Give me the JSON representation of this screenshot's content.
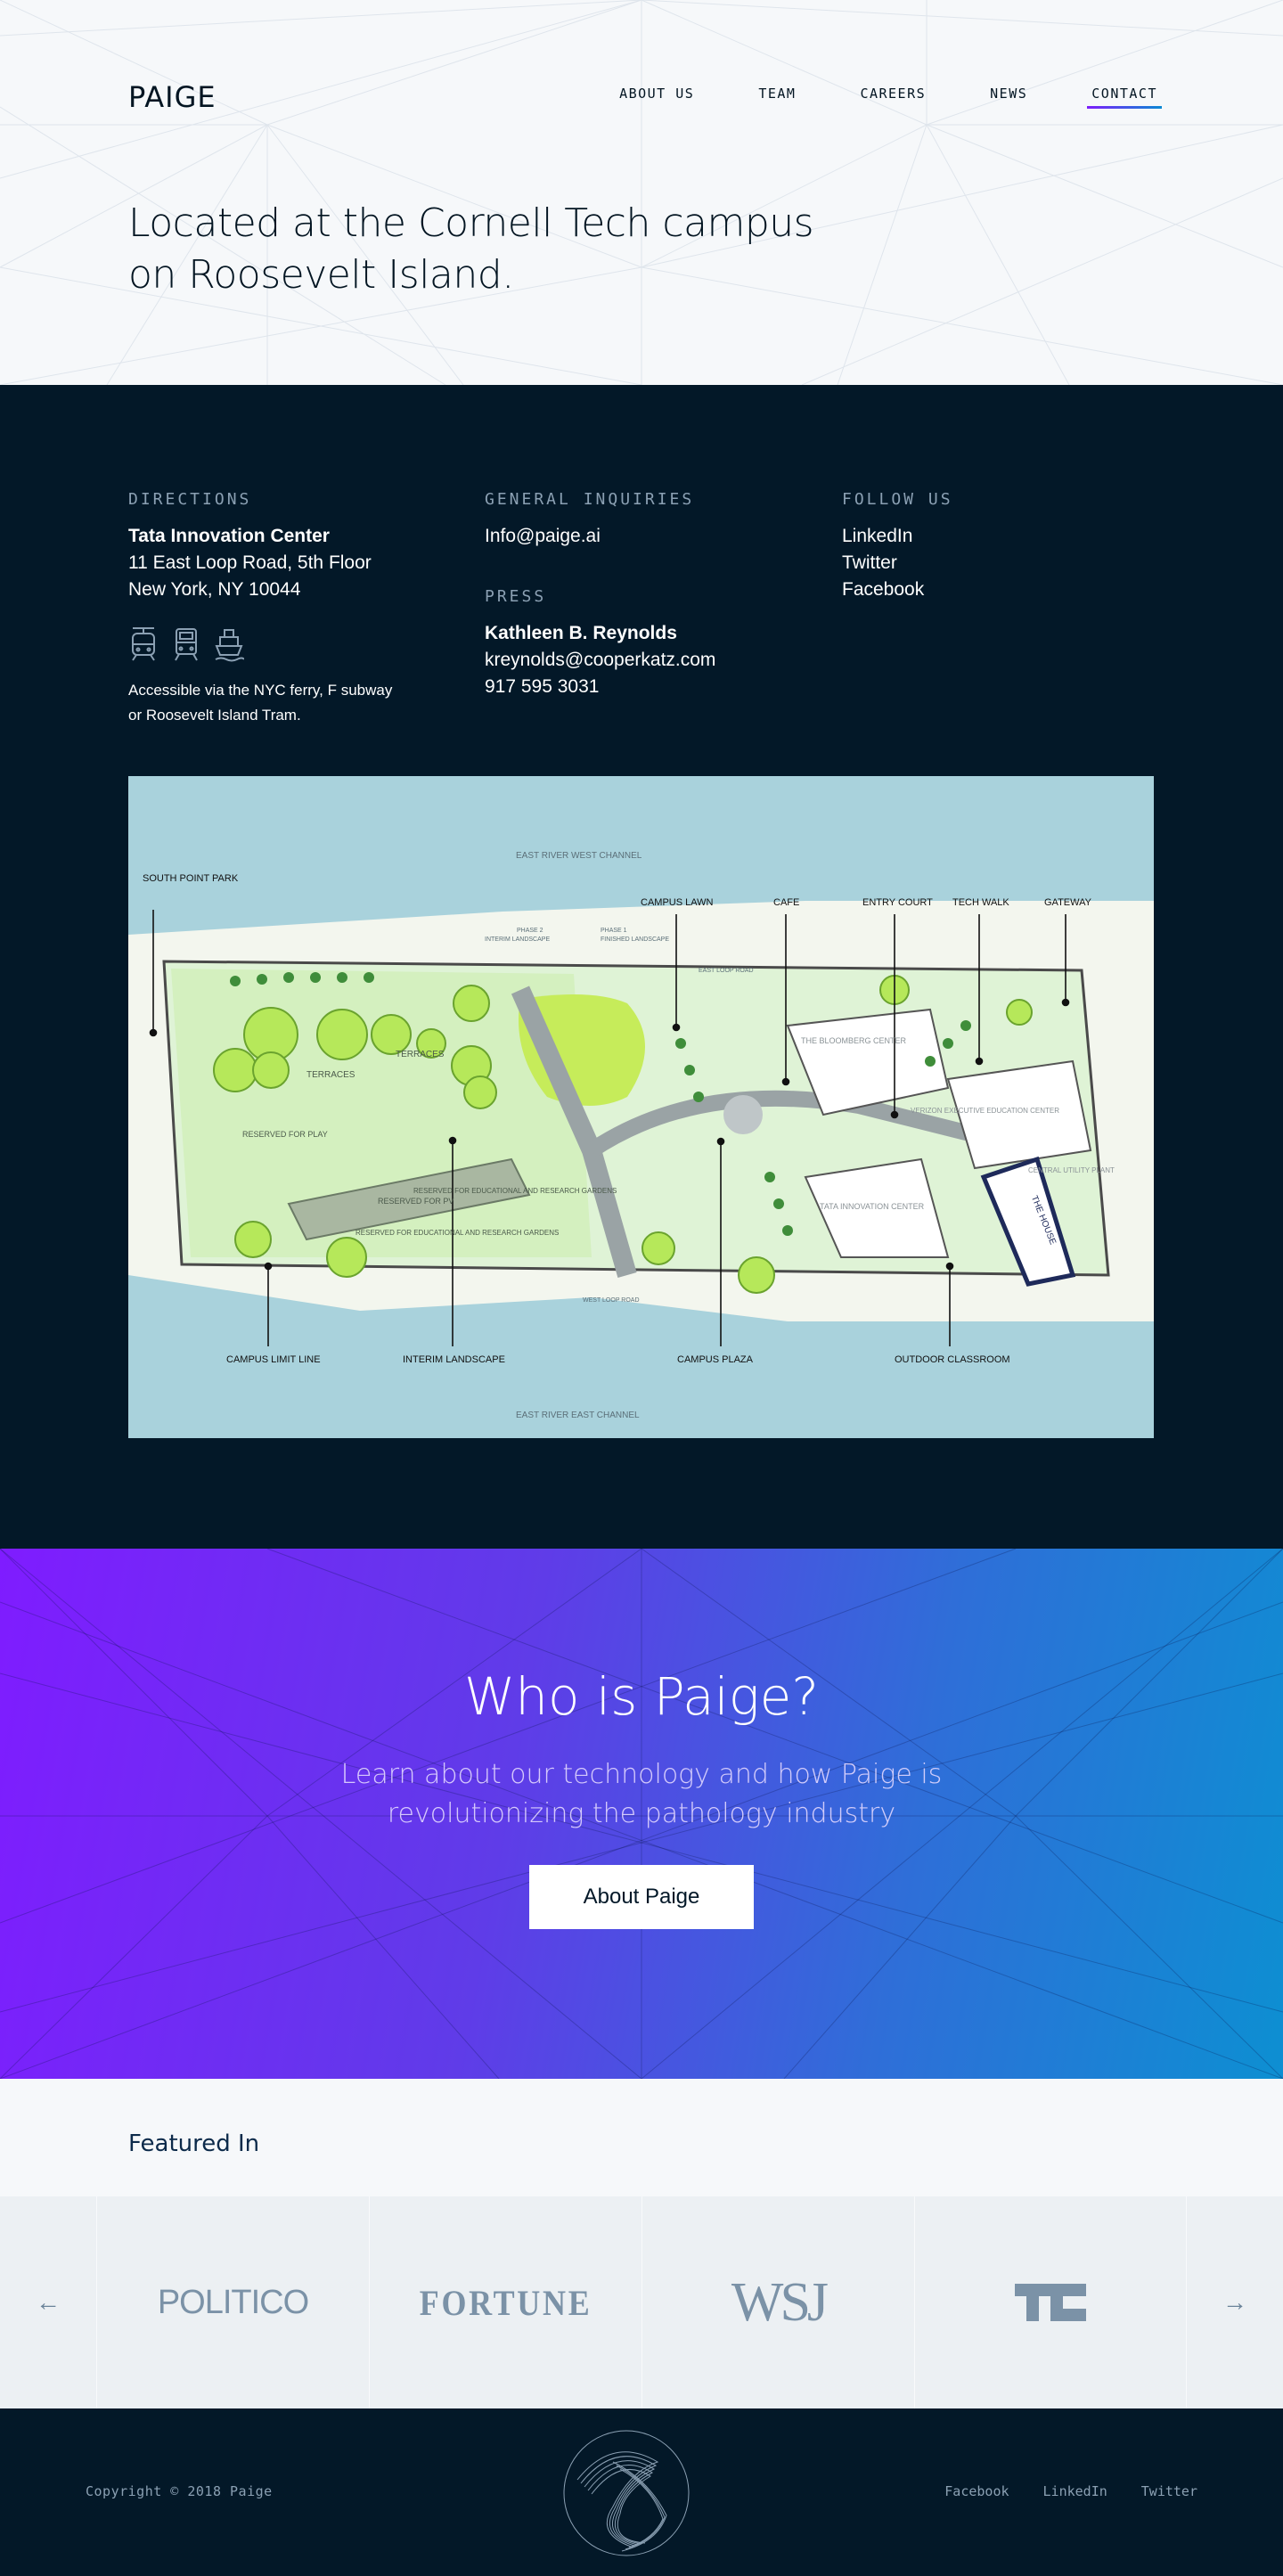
{
  "header": {
    "logo": "PAIGE",
    "nav": [
      {
        "label": "ABOUT US"
      },
      {
        "label": "TEAM"
      },
      {
        "label": "CAREERS"
      },
      {
        "label": "NEWS"
      },
      {
        "label": "CONTACT",
        "active": true
      }
    ],
    "title": "Located at the Cornell Tech campus on Roosevelt Island."
  },
  "directions": {
    "heading": "DIRECTIONS",
    "building": "Tata Innovation Center",
    "address1": "11 East Loop Road, 5th Floor",
    "address2": "New York, NY 10044",
    "transit_icons": [
      "tram-icon",
      "subway-icon",
      "ferry-icon"
    ],
    "access_note": "Accessible via the NYC ferry, F subway or Roosevelt Island Tram."
  },
  "inquiries": {
    "heading": "GENERAL INQUIRIES",
    "email": "Info@paige.ai"
  },
  "press": {
    "heading": "PRESS",
    "name": "Kathleen B. Reynolds",
    "email": "kreynolds@cooperkatz.com",
    "phone": "917 595 3031"
  },
  "follow": {
    "heading": "FOLLOW US",
    "links": [
      "LinkedIn",
      "Twitter",
      "Facebook"
    ]
  },
  "map": {
    "labels": {
      "west_channel": "EAST RIVER WEST CHANNEL",
      "east_channel": "EAST RIVER EAST CHANNEL",
      "south_point": "SOUTH POINT PARK",
      "campus_lawn": "CAMPUS LAWN",
      "cafe": "CAFE",
      "entry_court": "ENTRY COURT",
      "tech_walk": "TECH WALK",
      "gateway": "GATEWAY",
      "terraces1": "TERRACES",
      "terraces2": "TERRACES",
      "reserved_play": "RESERVED FOR PLAY",
      "reserved_pv": "RESERVED FOR PV",
      "reserved_edu": "RESERVED FOR EDUCATIONAL AND RESEARCH GARDENS",
      "reserved_edu2": "RESERVED FOR EDUCATIONAL AND RESEARCH GARDENS",
      "bloomberg": "THE BLOOMBERG CENTER",
      "verizon": "VERIZON EXECUTIVE EDUCATION CENTER",
      "tata": "TATA INNOVATION CENTER",
      "utility": "CENTRAL UTILITY PLANT",
      "house": "THE HOUSE",
      "campus_limit": "CAMPUS LIMIT LINE",
      "interim": "INTERIM LANDSCAPE",
      "plaza": "CAMPUS PLAZA",
      "classroom": "OUTDOOR CLASSROOM",
      "phase2": "PHASE 2",
      "phase1": "PHASE 1",
      "interim_small": "INTERIM LANDSCAPE",
      "finished_small": "FINISHED LANDSCAPE",
      "east_loop": "EAST LOOP ROAD",
      "west_loop": "WEST LOOP ROAD"
    }
  },
  "who": {
    "title": "Who is Paige?",
    "subtitle": "Learn about our technology and how Paige is revolutionizing the pathology industry",
    "button": "About Paige"
  },
  "featured": {
    "heading": "Featured In",
    "logos": [
      "POLITICO",
      "FORTUNE",
      "WSJ",
      "TechCrunch"
    ],
    "prev": "←",
    "next": "→"
  },
  "footer": {
    "copyright": "Copyright © 2018 Paige",
    "links": [
      "Facebook",
      "LinkedIn",
      "Twitter"
    ]
  }
}
